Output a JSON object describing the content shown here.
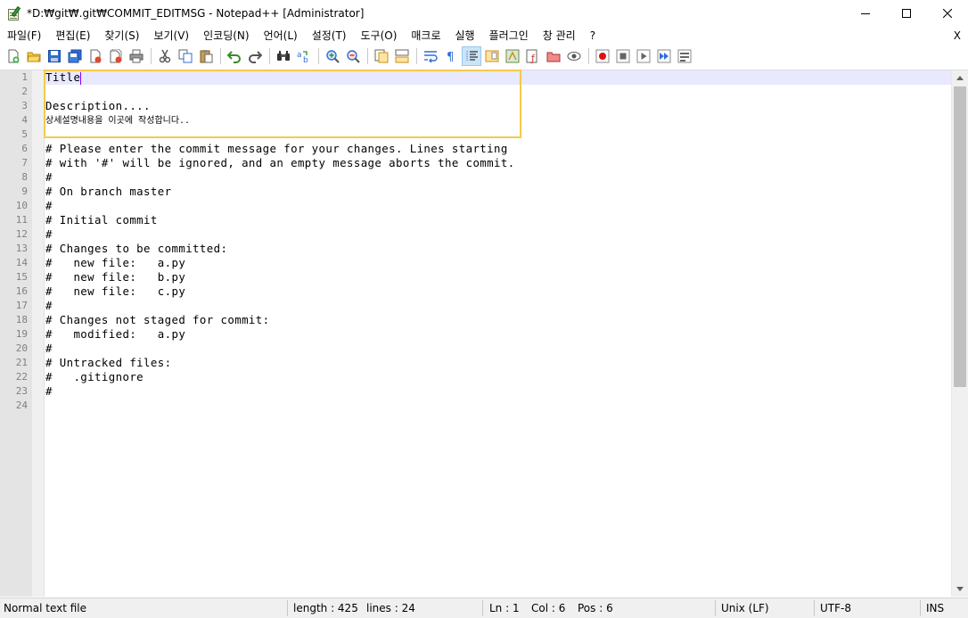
{
  "window": {
    "title": "*D:₩git₩.git₩COMMIT_EDITMSG - Notepad++ [Administrator]"
  },
  "menu": {
    "items": [
      "파일(F)",
      "편집(E)",
      "찾기(S)",
      "보기(V)",
      "인코딩(N)",
      "언어(L)",
      "설정(T)",
      "도구(O)",
      "매크로",
      "실행",
      "플러그인",
      "창 관리",
      "?"
    ],
    "close_label": "X"
  },
  "toolbar": {
    "icons": [
      "new-file-icon",
      "open-file-icon",
      "save-icon",
      "save-all-icon",
      "close-icon",
      "close-all-icon",
      "print-icon",
      "cut-icon",
      "copy-icon",
      "paste-icon",
      "undo-icon",
      "redo-icon",
      "find-icon",
      "replace-icon",
      "zoom-in-icon",
      "zoom-out-icon",
      "sync-vertical-icon",
      "sync-horizontal-icon",
      "word-wrap-icon",
      "show-all-chars-icon",
      "indent-guide-icon",
      "document-map-icon",
      "function-list-icon",
      "folder-workspace-icon",
      "monitoring-icon",
      "record-macro-icon",
      "stop-macro-icon",
      "play-macro-icon",
      "run-macro-multiple-icon",
      "save-macro-icon"
    ]
  },
  "editor": {
    "lines": [
      {
        "n": "1",
        "text": "Title"
      },
      {
        "n": "2",
        "text": ""
      },
      {
        "n": "3",
        "text": "Description...."
      },
      {
        "n": "4",
        "text": "상세설명내용을 이곳에 작성합니다.."
      },
      {
        "n": "5",
        "text": ""
      },
      {
        "n": "6",
        "text": "# Please enter the commit message for your changes. Lines starting"
      },
      {
        "n": "7",
        "text": "# with '#' will be ignored, and an empty message aborts the commit."
      },
      {
        "n": "8",
        "text": "#"
      },
      {
        "n": "9",
        "text": "# On branch master"
      },
      {
        "n": "10",
        "text": "#"
      },
      {
        "n": "11",
        "text": "# Initial commit"
      },
      {
        "n": "12",
        "text": "#"
      },
      {
        "n": "13",
        "text": "# Changes to be committed:"
      },
      {
        "n": "14",
        "text": "#   new file:   a.py"
      },
      {
        "n": "15",
        "text": "#   new file:   b.py"
      },
      {
        "n": "16",
        "text": "#   new file:   c.py"
      },
      {
        "n": "17",
        "text": "#"
      },
      {
        "n": "18",
        "text": "# Changes not staged for commit:"
      },
      {
        "n": "19",
        "text": "#   modified:   a.py"
      },
      {
        "n": "20",
        "text": "#"
      },
      {
        "n": "21",
        "text": "# Untracked files:"
      },
      {
        "n": "22",
        "text": "#   .gitignore"
      },
      {
        "n": "23",
        "text": "#"
      },
      {
        "n": "24",
        "text": ""
      }
    ]
  },
  "statusbar": {
    "file_type": "Normal text file",
    "length": "length : 425",
    "lines": "lines : 24",
    "ln": "Ln : 1",
    "col": "Col : 6",
    "pos": "Pos : 6",
    "eol": "Unix (LF)",
    "encoding": "UTF-8",
    "mode": "INS"
  },
  "colors": {
    "highlight_box": "#f5c94c",
    "current_line": "#e8e8ff",
    "caret": "#8000ff"
  }
}
